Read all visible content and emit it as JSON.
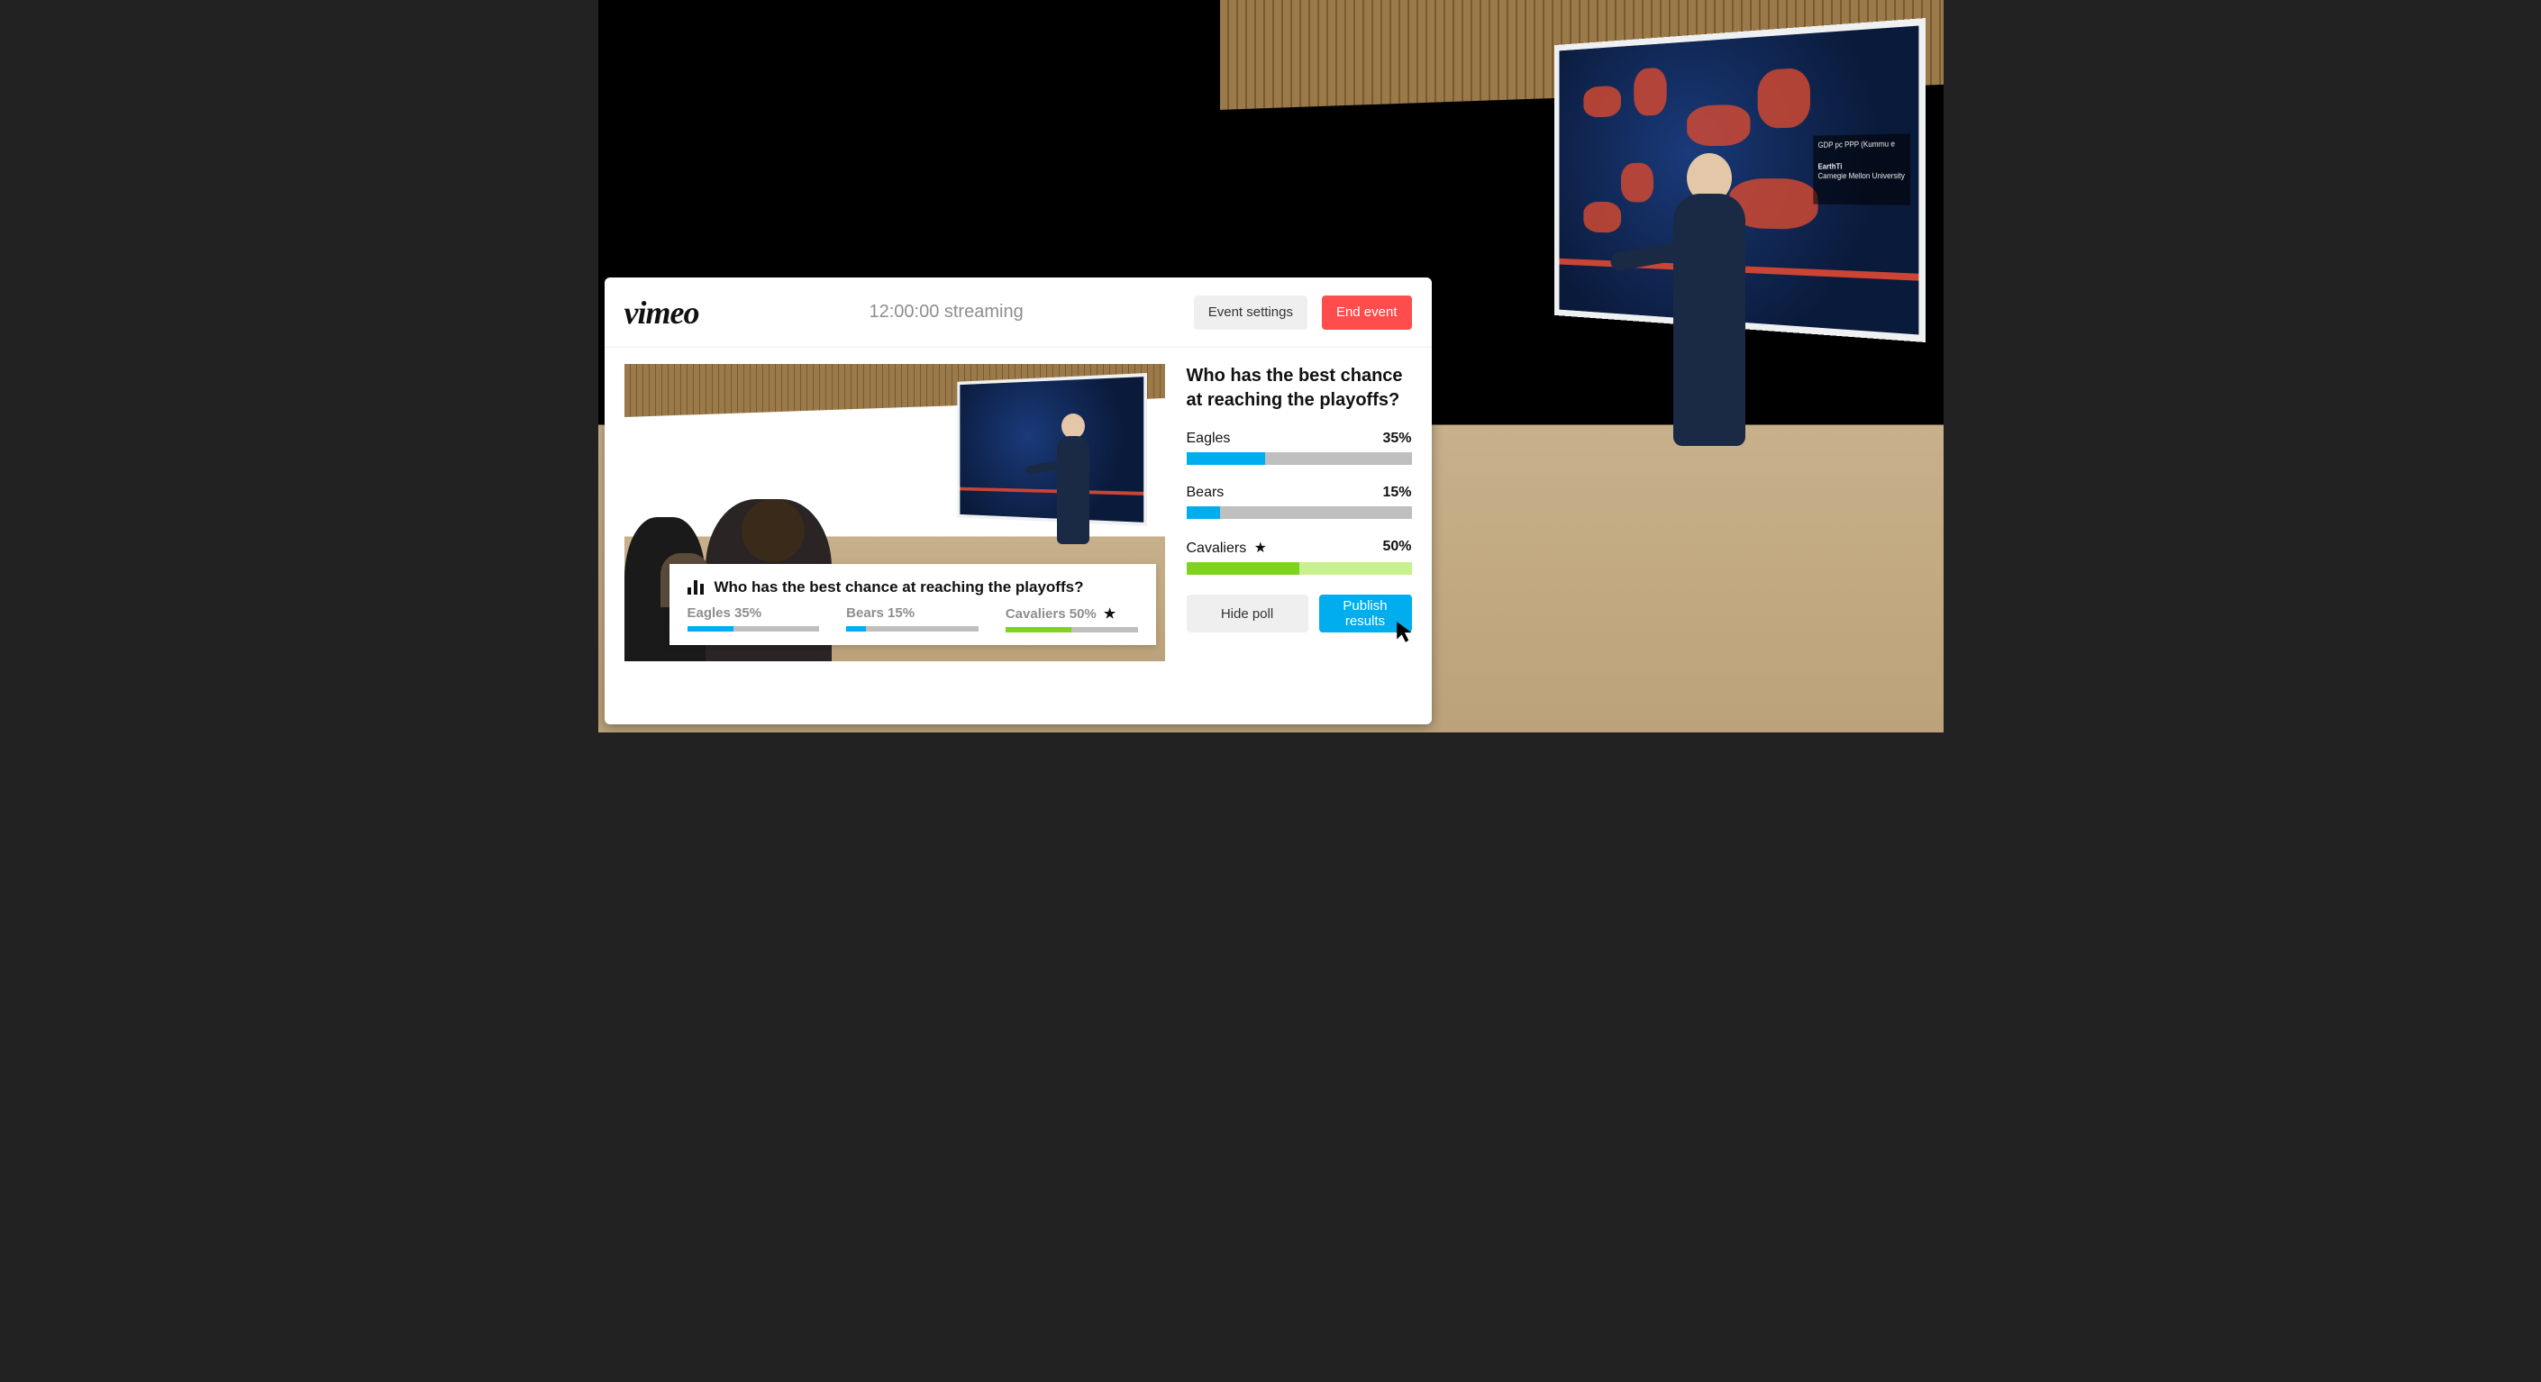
{
  "header": {
    "logo_text": "imeo",
    "streaming_label": "12:00:00 streaming",
    "settings_label": "Event settings",
    "end_label": "End event"
  },
  "poll": {
    "question": "Who has the best chance at reaching the playoffs?",
    "options": [
      {
        "name": "Eagles",
        "percent": 35,
        "display": "35%",
        "color": "#00adee",
        "winner": false
      },
      {
        "name": "Bears",
        "percent": 15,
        "display": "15%",
        "color": "#00adee",
        "winner": false
      },
      {
        "name": "Cavaliers",
        "percent": 50,
        "display": "50%",
        "color": "#7ed321",
        "winner": true
      }
    ],
    "actions": {
      "hide_label": "Hide poll",
      "publish_label": "Publish results"
    }
  },
  "overlay": {
    "question": "Who has the best chance at reaching the playoffs?",
    "results": [
      {
        "label": "Eagles 35%",
        "percent": 35,
        "color": "#00adee",
        "winner": false
      },
      {
        "label": "Bears 15%",
        "percent": 15,
        "color": "#00adee",
        "winner": false
      },
      {
        "label": "Cavaliers 50%",
        "percent": 50,
        "color": "#7ed321",
        "winner": true
      }
    ]
  },
  "chart_data": {
    "type": "bar",
    "title": "Who has the best chance at reaching the playoffs?",
    "categories": [
      "Eagles",
      "Bears",
      "Cavaliers"
    ],
    "values": [
      35,
      15,
      50
    ],
    "ylabel": "%",
    "ylim": [
      0,
      100
    ]
  },
  "background_screen": {
    "legend_title": "GDP pc PPP (Kummu e",
    "brand": "EarthTi",
    "subtitle": "Carnegie Mellon University"
  }
}
